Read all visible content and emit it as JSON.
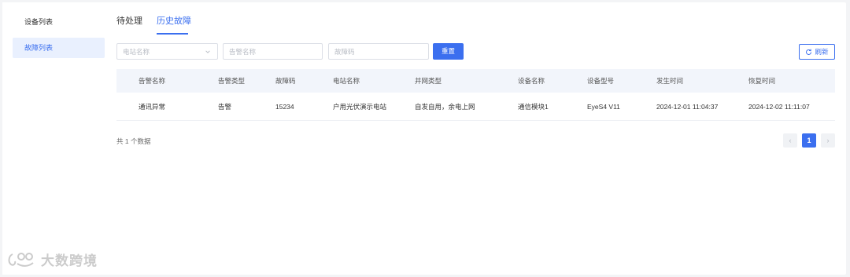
{
  "sidebar": {
    "items": [
      {
        "label": "设备列表"
      },
      {
        "label": "故障列表"
      }
    ]
  },
  "tabs": [
    {
      "label": "待处理"
    },
    {
      "label": "历史故障"
    }
  ],
  "filters": {
    "station_placeholder": "电站名称",
    "alarm_placeholder": "告警名称",
    "fault_code_placeholder": "故障码"
  },
  "buttons": {
    "reset": "重置",
    "refresh": "刷新"
  },
  "table": {
    "headers": [
      "告警名称",
      "告警类型",
      "故障码",
      "电站名称",
      "并网类型",
      "设备名称",
      "设备型号",
      "发生时间",
      "恢复时间"
    ],
    "rows": [
      [
        "通讯异常",
        "告警",
        "15234",
        "户用光伏演示电站",
        "自发自用，余电上网",
        "通信模块1",
        "EyeS4 V11",
        "2024-12-01 11:04:37",
        "2024-12-02 11:11:07"
      ]
    ]
  },
  "pagination": {
    "total_text": "共 1 个数据",
    "prev": "‹",
    "current": "1",
    "next": "›"
  },
  "watermark": {
    "text": "大数跨境"
  },
  "colors": {
    "accent": "#3b6fef",
    "sidebar_active_bg": "#e9f0fe",
    "table_header_bg": "#f2f5fb"
  }
}
